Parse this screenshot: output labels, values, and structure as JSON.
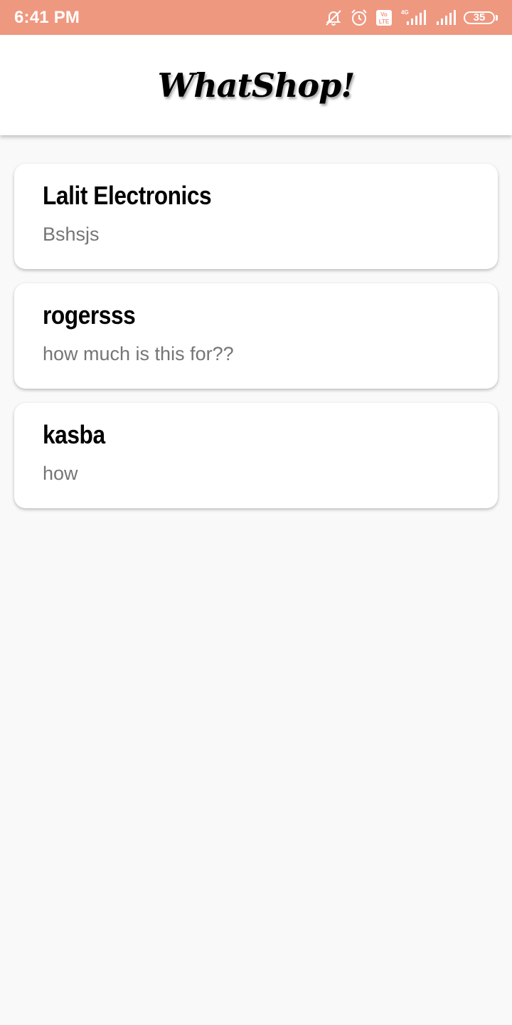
{
  "status_bar": {
    "time": "6:41 PM",
    "network_label": "4G",
    "volte_label": "Vo LTE",
    "battery": "35",
    "icons": [
      "mute-icon",
      "alarm-icon",
      "volte-icon",
      "signal-icon",
      "battery-icon"
    ]
  },
  "app_bar": {
    "title": "WhatShop!"
  },
  "chats": [
    {
      "name": "Lalit Electronics",
      "last_message": "Bshsjs"
    },
    {
      "name": "rogersss",
      "last_message": "how much is this for??"
    },
    {
      "name": "kasba",
      "last_message": "how"
    }
  ],
  "colors": {
    "status_bar": "#ef9880",
    "background": "#f9f9f9",
    "card": "#ffffff",
    "secondary_text": "#757575"
  }
}
